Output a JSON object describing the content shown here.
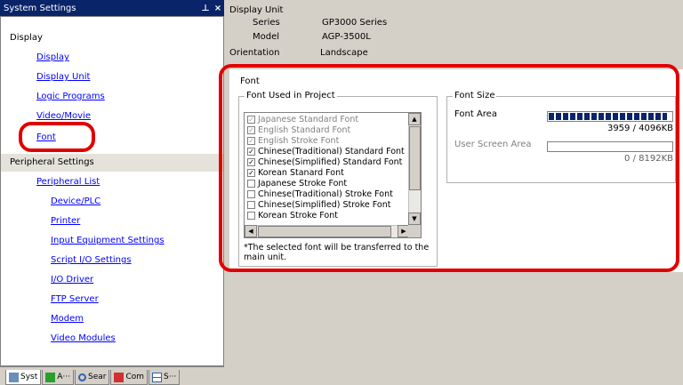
{
  "left_panel": {
    "title": "System Settings",
    "pin_glyph": "⊥",
    "close_glyph": "×",
    "sections": {
      "display": "Display",
      "peripheral": "Peripheral Settings"
    },
    "display_items": [
      "Display",
      "Display Unit",
      "Logic Programs",
      "Video/Movie",
      "Font"
    ],
    "peripheral_items": [
      "Peripheral List",
      "Device/PLC",
      "Printer",
      "Input Equipment Settings",
      "Script I/O Settings",
      "I/O Driver",
      "FTP Server",
      "Modem",
      "Video Modules"
    ],
    "bottom_tabs": [
      "Syst",
      "A···",
      "Sear",
      "Com",
      "S···"
    ]
  },
  "display_unit": {
    "heading": "Display Unit",
    "rows": [
      {
        "label": "Series",
        "value": "GP3000 Series"
      },
      {
        "label": "Model",
        "value": "AGP-3500L"
      },
      {
        "label": "Orientation",
        "value": "Landscape"
      }
    ]
  },
  "font": {
    "heading": "Font",
    "used_group_title": "Font Used in Project",
    "fonts": [
      {
        "label": "Japanese Standard Font",
        "checked": true,
        "disabled": true
      },
      {
        "label": "English Standard Font",
        "checked": true,
        "disabled": true
      },
      {
        "label": "English Stroke Font",
        "checked": true,
        "disabled": true
      },
      {
        "label": "Chinese(Traditional) Standard Font",
        "checked": true,
        "disabled": false
      },
      {
        "label": "Chinese(Simplified) Standard Font",
        "checked": true,
        "disabled": false
      },
      {
        "label": "Korean Stanard Font",
        "checked": true,
        "disabled": false
      },
      {
        "label": "Japanese Stroke Font",
        "checked": false,
        "disabled": false
      },
      {
        "label": "Chinese(Traditional) Stroke Font",
        "checked": false,
        "disabled": false
      },
      {
        "label": "Chinese(Simplified) Stroke Font",
        "checked": false,
        "disabled": false
      },
      {
        "label": "Korean Stroke Font",
        "checked": false,
        "disabled": false
      }
    ],
    "note": "*The selected font will be transferred to the main unit.",
    "size_group_title": "Font Size",
    "font_area_label": "Font Area",
    "font_area_value": "3959 / 4096KB",
    "font_area_fraction": 0.967,
    "user_area_label": "User Screen Area",
    "user_area_value": "0 / 8192KB",
    "user_area_fraction": 0
  },
  "colors": {
    "titlebar": "#0a246a",
    "link": "#0000ff",
    "highlight": "#e00000"
  }
}
